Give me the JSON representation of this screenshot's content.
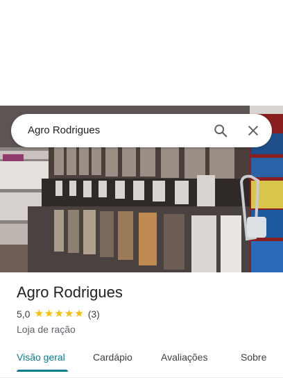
{
  "search": {
    "query": "Agro Rodrigues",
    "search_icon": "search-icon",
    "close_icon": "close-icon"
  },
  "place": {
    "name": "Agro Rodrigues",
    "rating": "5,0",
    "stars": 5,
    "review_count": "(3)",
    "category": "Loja de ração"
  },
  "tabs": [
    {
      "label": "Visão geral",
      "active": true
    },
    {
      "label": "Cardápio",
      "active": false
    },
    {
      "label": "Avaliações",
      "active": false
    },
    {
      "label": "Sobre",
      "active": false
    }
  ],
  "colors": {
    "accent": "#0b7c8f",
    "star": "#fbbc04",
    "text": "#202124",
    "secondary": "#5f6368"
  }
}
